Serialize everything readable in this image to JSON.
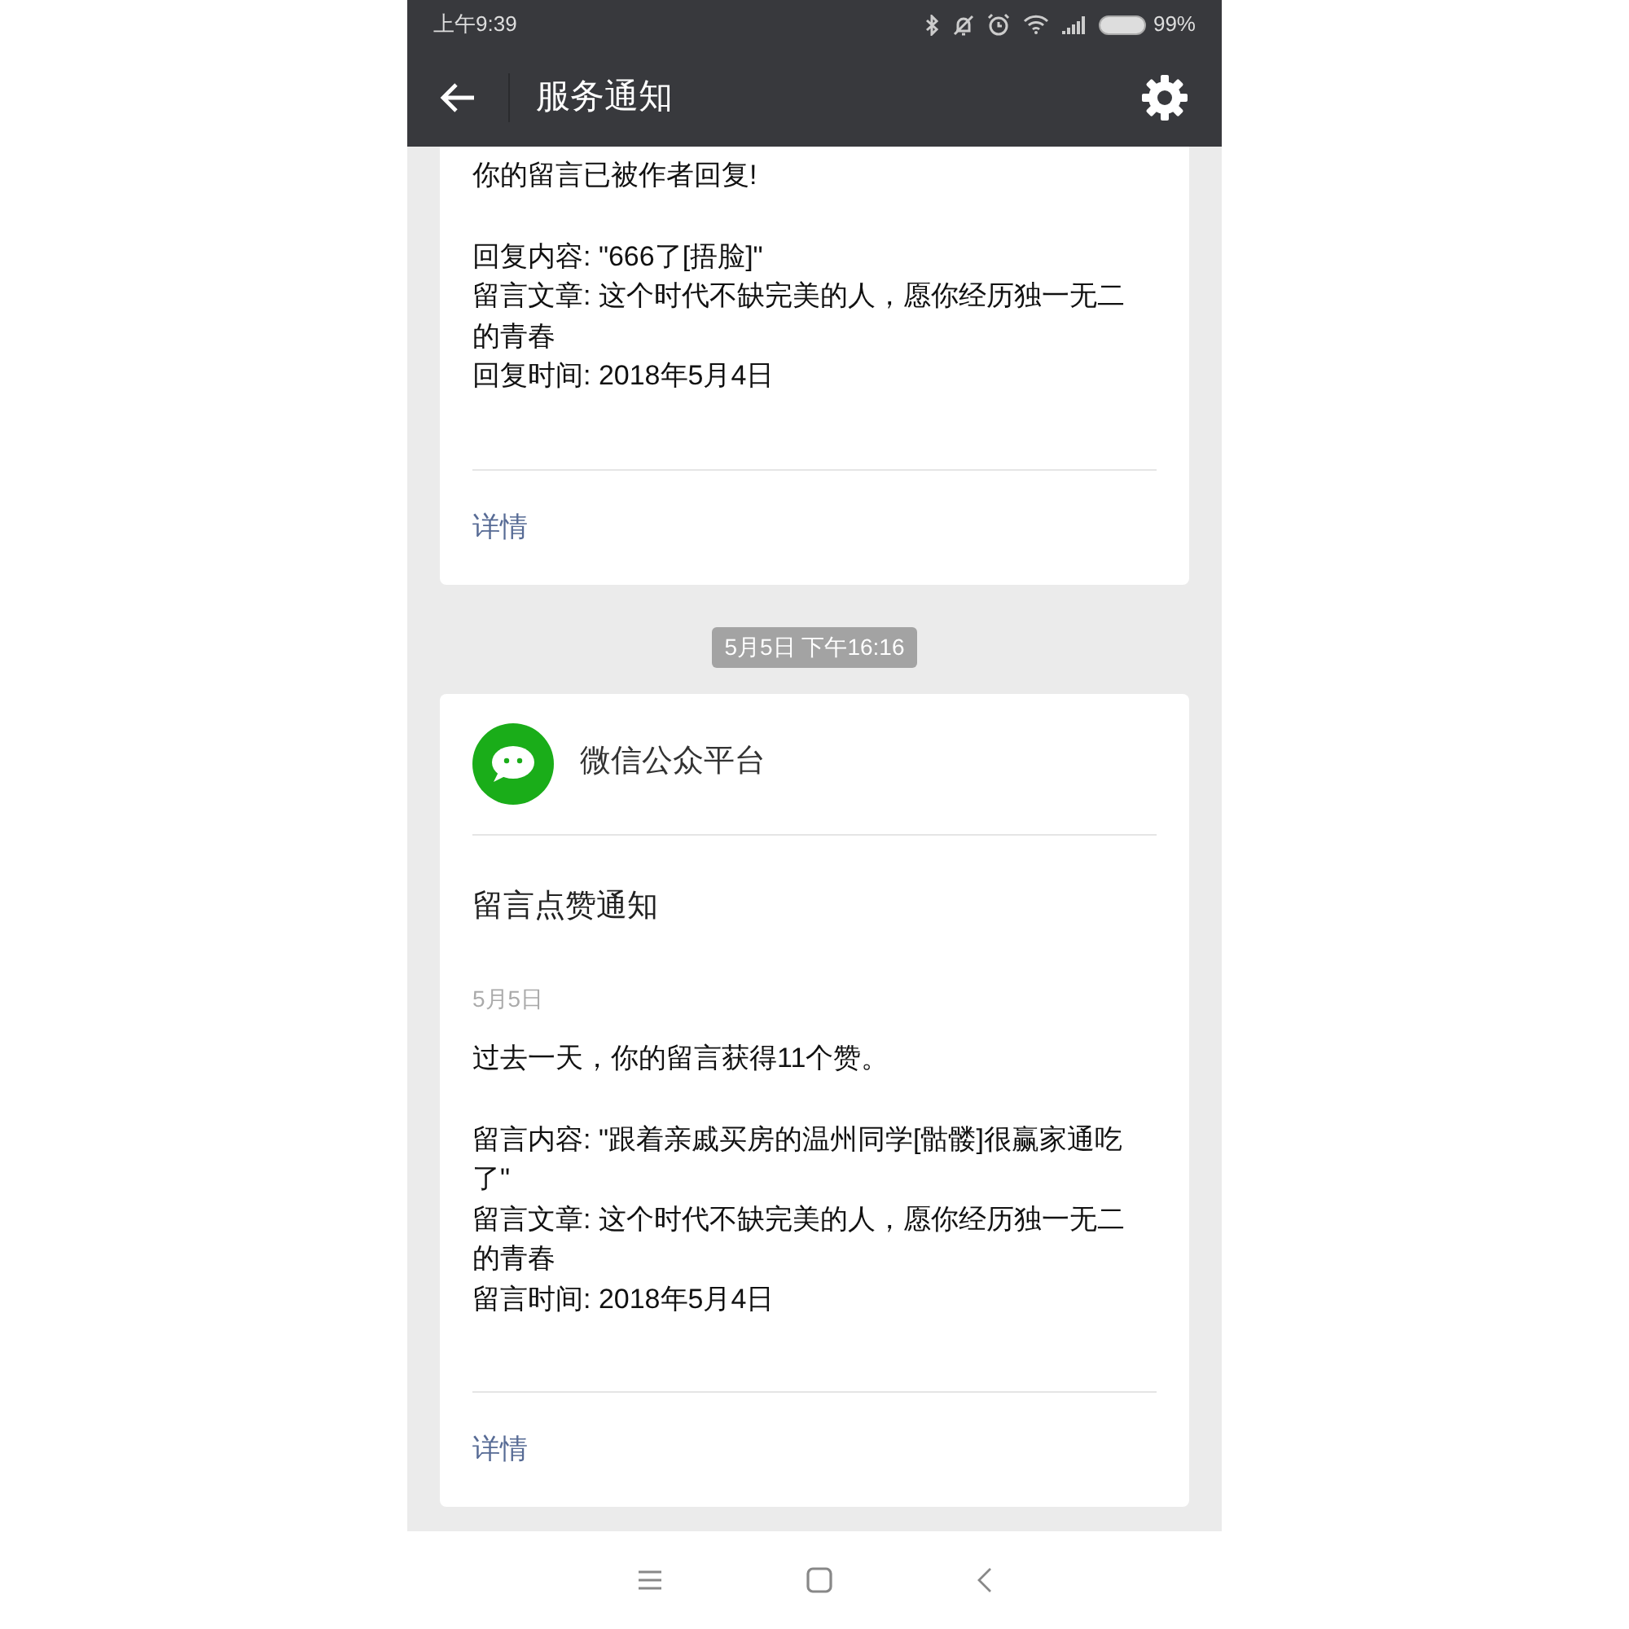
{
  "status_bar": {
    "time": "上午9:39",
    "battery": "99%"
  },
  "title_bar": {
    "title": "服务通知"
  },
  "messages": [
    {
      "kind": "card",
      "summary": "你的留言已被作者回复!",
      "details": [
        "回复内容: \"666了[捂脸]\"",
        "留言文章: 这个时代不缺完美的人，愿你经历独一无二的青春",
        "回复时间: 2018年5月4日"
      ],
      "link": "详情"
    },
    {
      "kind": "timestamp",
      "text": "5月5日 下午16:16"
    },
    {
      "kind": "card",
      "sender": "微信公众平台",
      "title": "留言点赞通知",
      "date": "5月5日",
      "summary": "过去一天，你的留言获得11个赞。",
      "details": [
        "留言内容: \"跟着亲戚买房的温州同学[骷髅]很赢家通吃了\"",
        "留言文章: 这个时代不缺完美的人，愿你经历独一无二的青春",
        "留言时间: 2018年5月4日"
      ],
      "link": "详情"
    }
  ]
}
